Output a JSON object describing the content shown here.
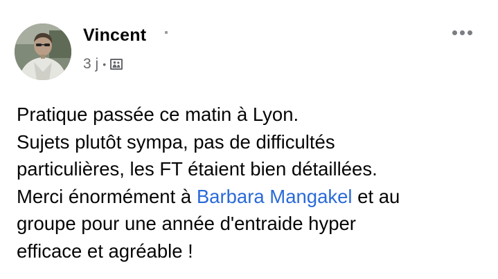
{
  "post": {
    "author_name": "Vincent",
    "timestamp": "3 j",
    "separator": "•",
    "audience_icon": "audience-icon",
    "more_icon": "more-options-icon",
    "text": {
      "line1": "Pratique passée ce matin à Lyon.",
      "line2": "Sujets plutôt sympa, pas de difficultés",
      "line3": "particulières, les FT étaient bien détaillées.",
      "line4_before": "Merci énormément à ",
      "mention": "Barbara Mangakel",
      "line4_after": " et au",
      "line5": "groupe pour une année d'entraide hyper",
      "line6": "efficace et agréable !"
    }
  },
  "colors": {
    "top_strip": "#c9ccd1",
    "text": "#050505",
    "meta": "#65676b",
    "mention": "#2a6ad9"
  }
}
